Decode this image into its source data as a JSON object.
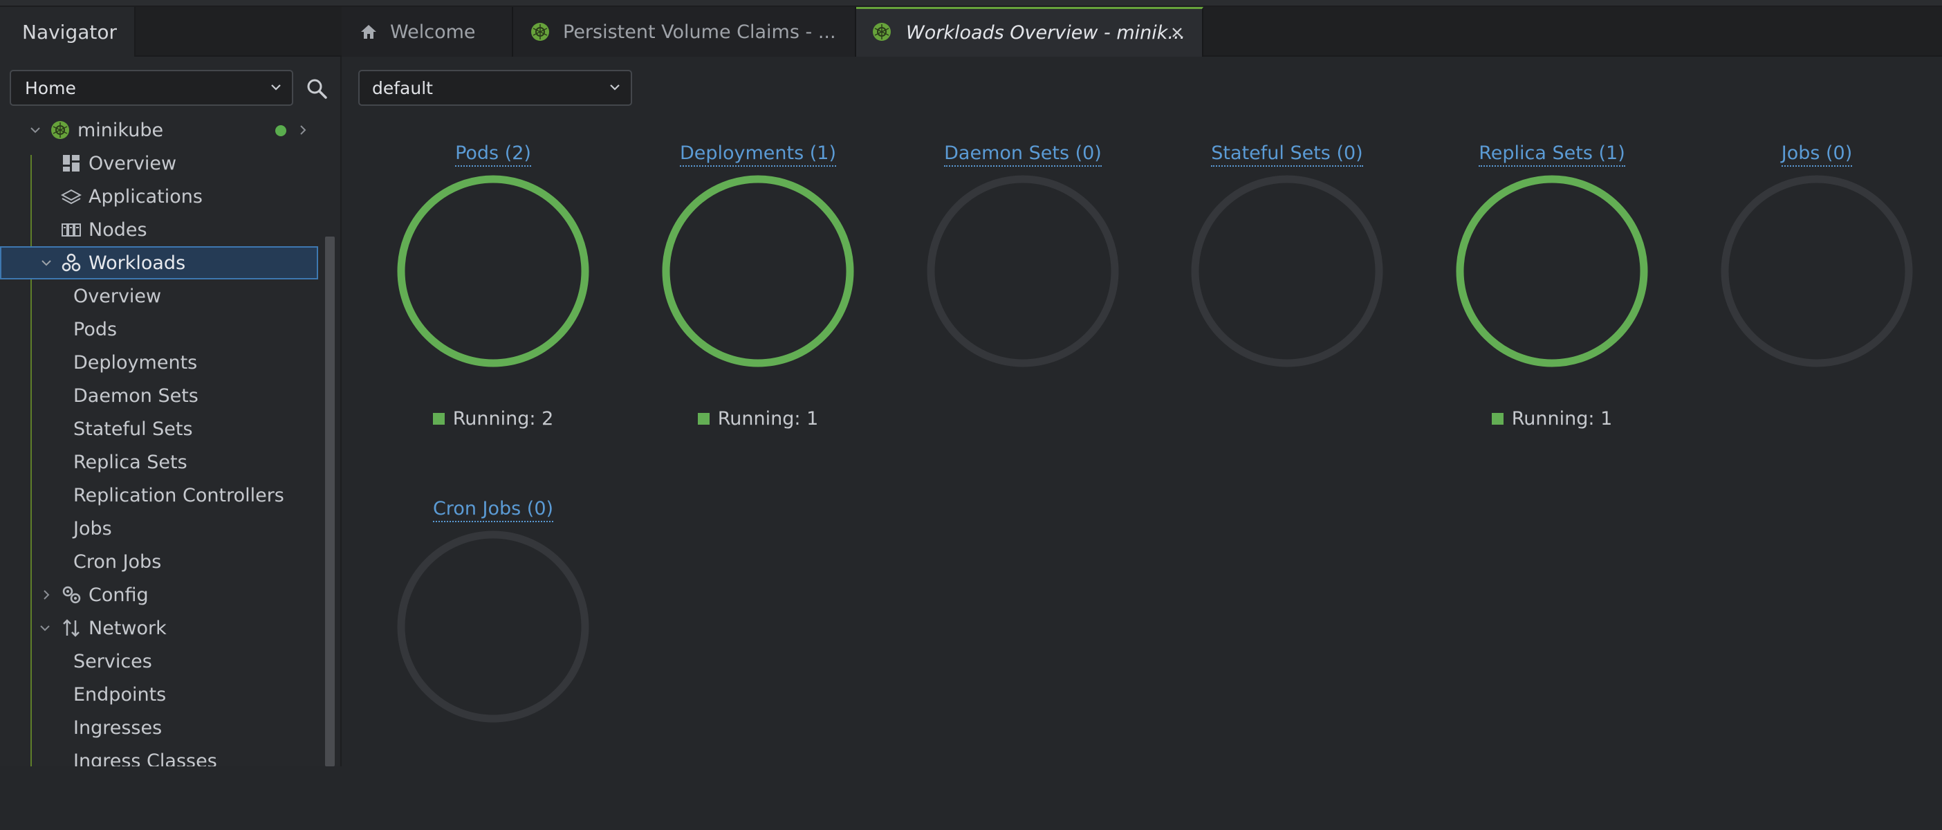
{
  "navigator": {
    "title": "Navigator",
    "context_select": "Home",
    "tree": [
      {
        "label": "minikube",
        "level": 0
      },
      {
        "label": "Overview",
        "level": 1
      },
      {
        "label": "Applications",
        "level": 1
      },
      {
        "label": "Nodes",
        "level": 1
      },
      {
        "label": "Workloads",
        "level": 1
      },
      {
        "label": "Overview",
        "level": 2
      },
      {
        "label": "Pods",
        "level": 2
      },
      {
        "label": "Deployments",
        "level": 2
      },
      {
        "label": "Daemon Sets",
        "level": 2
      },
      {
        "label": "Stateful Sets",
        "level": 2
      },
      {
        "label": "Replica Sets",
        "level": 2
      },
      {
        "label": "Replication Controllers",
        "level": 2
      },
      {
        "label": "Jobs",
        "level": 2
      },
      {
        "label": "Cron Jobs",
        "level": 2
      },
      {
        "label": "Config",
        "level": 1
      },
      {
        "label": "Network",
        "level": 1
      },
      {
        "label": "Services",
        "level": 2
      },
      {
        "label": "Endpoints",
        "level": 2
      },
      {
        "label": "Ingresses",
        "level": 2
      },
      {
        "label": "Ingress Classes",
        "level": 2
      }
    ]
  },
  "tabs": [
    {
      "label": "Welcome",
      "icon": "home-icon"
    },
    {
      "label": "Persistent Volume Claims - ...",
      "icon": "kubernetes-icon"
    },
    {
      "label": "Workloads Overview - minik...",
      "icon": "kubernetes-icon",
      "active": true
    }
  ],
  "namespace_select": "default",
  "workloads": [
    {
      "title": "Pods (2)",
      "running": "Running: 2",
      "active": true
    },
    {
      "title": "Deployments (1)",
      "running": "Running: 1",
      "active": true
    },
    {
      "title": "Daemon Sets (0)",
      "running": "",
      "active": false
    },
    {
      "title": "Stateful Sets (0)",
      "running": "",
      "active": false
    },
    {
      "title": "Replica Sets (1)",
      "running": "Running: 1",
      "active": true
    },
    {
      "title": "Jobs (0)",
      "running": "",
      "active": false
    },
    {
      "title": "Cron Jobs (0)",
      "running": "",
      "active": false
    }
  ],
  "colors": {
    "running": "#63ae54",
    "empty_ring": "#35373b",
    "link": "#5b9bd5",
    "selection": "#253b55"
  }
}
